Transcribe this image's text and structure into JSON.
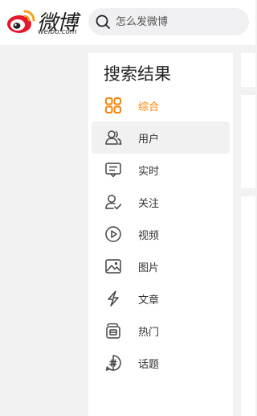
{
  "brand": {
    "name": "微博",
    "sub": "weibo.com"
  },
  "search": {
    "placeholder": "怎么发微博"
  },
  "panel": {
    "title": "搜索结果",
    "items": [
      {
        "label": "综合",
        "icon": "grid-icon",
        "selected": true
      },
      {
        "label": "用户",
        "icon": "users-icon",
        "hover": true
      },
      {
        "label": "实时",
        "icon": "realtime-icon"
      },
      {
        "label": "关注",
        "icon": "follow-icon"
      },
      {
        "label": "视频",
        "icon": "video-icon"
      },
      {
        "label": "图片",
        "icon": "image-icon"
      },
      {
        "label": "文章",
        "icon": "article-icon"
      },
      {
        "label": "热门",
        "icon": "hot-icon"
      },
      {
        "label": "话题",
        "icon": "topic-icon"
      }
    ]
  },
  "colors": {
    "accent": "#ff8200",
    "text": "#333333",
    "page_bg": "#f2f2f2"
  }
}
